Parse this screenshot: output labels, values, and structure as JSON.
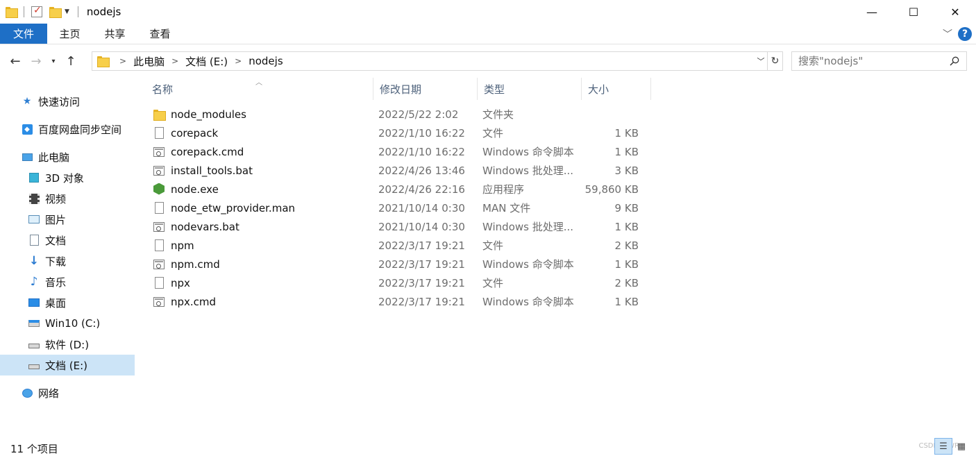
{
  "window": {
    "title": "nodejs",
    "minimize": "—",
    "maximize": "☐",
    "close": "✕"
  },
  "ribbon": {
    "tabs": [
      "文件",
      "主页",
      "共享",
      "查看"
    ],
    "collapse": "﹀",
    "help": "?"
  },
  "nav": {
    "back": "←",
    "forward": "→",
    "recent": "▾",
    "up": "↑",
    "breadcrumb": [
      "此电脑",
      "文档 (E:)",
      "nodejs"
    ],
    "dropdown": "﹀",
    "refresh": "↻",
    "search_placeholder": "搜索\"nodejs\""
  },
  "sidebar": {
    "items": [
      {
        "label": "快速访问",
        "icon": "star-icon"
      },
      {
        "label": "百度网盘同步空间",
        "icon": "cloud-sync-icon"
      },
      {
        "label": "此电脑",
        "icon": "computer-icon"
      },
      {
        "label": "3D 对象",
        "icon": "cube-icon"
      },
      {
        "label": "视频",
        "icon": "film-icon"
      },
      {
        "label": "图片",
        "icon": "picture-icon"
      },
      {
        "label": "文档",
        "icon": "document-icon"
      },
      {
        "label": "下载",
        "icon": "download-icon"
      },
      {
        "label": "音乐",
        "icon": "music-icon"
      },
      {
        "label": "桌面",
        "icon": "desktop-icon"
      },
      {
        "label": "Win10 (C:)",
        "icon": "windows-drive-icon"
      },
      {
        "label": "软件 (D:)",
        "icon": "drive-icon"
      },
      {
        "label": "文档 (E:)",
        "icon": "drive-icon"
      },
      {
        "label": "网络",
        "icon": "network-icon"
      }
    ],
    "selected": "文档 (E:)"
  },
  "columns": {
    "name": "名称",
    "date": "修改日期",
    "type": "类型",
    "size": "大小"
  },
  "files": [
    {
      "name": "node_modules",
      "date": "2022/5/22 2:02",
      "type": "文件夹",
      "size": "",
      "icon": "folder-icon"
    },
    {
      "name": "corepack",
      "date": "2022/1/10 16:22",
      "type": "文件",
      "size": "1 KB",
      "icon": "file-icon"
    },
    {
      "name": "corepack.cmd",
      "date": "2022/1/10 16:22",
      "type": "Windows 命令脚本",
      "size": "1 KB",
      "icon": "script-icon"
    },
    {
      "name": "install_tools.bat",
      "date": "2022/4/26 13:46",
      "type": "Windows 批处理...",
      "size": "3 KB",
      "icon": "script-icon"
    },
    {
      "name": "node.exe",
      "date": "2022/4/26 22:16",
      "type": "应用程序",
      "size": "59,860 KB",
      "icon": "node-exe-icon"
    },
    {
      "name": "node_etw_provider.man",
      "date": "2021/10/14 0:30",
      "type": "MAN 文件",
      "size": "9 KB",
      "icon": "file-icon"
    },
    {
      "name": "nodevars.bat",
      "date": "2021/10/14 0:30",
      "type": "Windows 批处理...",
      "size": "1 KB",
      "icon": "script-icon"
    },
    {
      "name": "npm",
      "date": "2022/3/17 19:21",
      "type": "文件",
      "size": "2 KB",
      "icon": "file-icon"
    },
    {
      "name": "npm.cmd",
      "date": "2022/3/17 19:21",
      "type": "Windows 命令脚本",
      "size": "1 KB",
      "icon": "script-icon"
    },
    {
      "name": "npx",
      "date": "2022/3/17 19:21",
      "type": "文件",
      "size": "2 KB",
      "icon": "file-icon"
    },
    {
      "name": "npx.cmd",
      "date": "2022/3/17 19:21",
      "type": "Windows 命令脚本",
      "size": "1 KB",
      "icon": "script-icon"
    }
  ],
  "status": {
    "count": "11 个项目",
    "watermark": "CSDN @WR"
  },
  "colors": {
    "accent": "#1e6fc6",
    "selected": "#cce4f7"
  }
}
